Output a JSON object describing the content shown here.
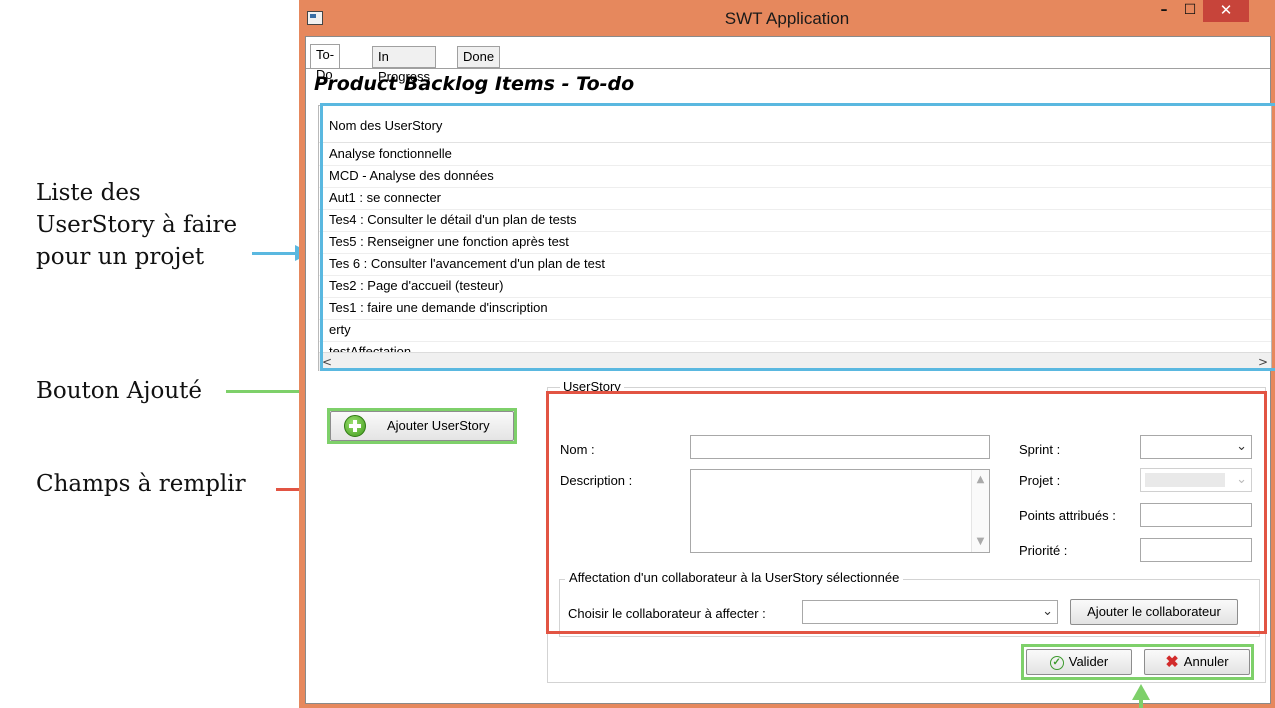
{
  "annotations": {
    "list_label": [
      "Liste des",
      "UserStory à faire",
      "pour un projet"
    ],
    "add_button_label": "Bouton Ajouté",
    "fields_label": "Champs à remplir",
    "colors": {
      "blue": "#5ab8e0",
      "green": "#7ed06a",
      "red": "#e25443"
    }
  },
  "window": {
    "title": "SWT Application",
    "minimize": "–",
    "maximize": "☐",
    "close": "✕",
    "frame_color": "#e6885d"
  },
  "tabs": [
    {
      "label": "To-Do",
      "active": true
    },
    {
      "label": "In Progress",
      "active": false
    },
    {
      "label": "Done",
      "active": false
    }
  ],
  "heading": "Product Backlog Items - To-do",
  "table": {
    "column": "Nom des UserStory",
    "rows": [
      "Analyse fonctionnelle",
      "MCD - Analyse des données",
      "Aut1 : se connecter",
      "Tes4 : Consulter le détail d'un plan de tests",
      "Tes5 : Renseigner une fonction après test",
      "Tes 6 : Consulter l'avancement d'un plan de test",
      "Tes2 : Page d'accueil (testeur)",
      "Tes1 : faire une demande d'inscription",
      "erty",
      "testAffectation"
    ],
    "scroll_left": "<",
    "scroll_right": ">"
  },
  "add_button": {
    "label": "Ajouter UserStory",
    "icon": "plus-circle-icon"
  },
  "form": {
    "legend": "UserStory",
    "nom_label": "Nom :",
    "nom_value": "",
    "description_label": "Description :",
    "description_value": "",
    "sprint_label": "Sprint :",
    "sprint_value": "",
    "projet_label": "Projet :",
    "projet_value": "",
    "points_label": "Points attribués :",
    "points_value": "",
    "priorite_label": "Priorité :",
    "priorite_value": "",
    "affectation": {
      "legend": "Affectation d'un collaborateur à la UserStory sélectionnée",
      "choose_label": "Choisir le collaborateur à affecter :",
      "choose_value": "",
      "add_button": "Ajouter le collaborateur"
    }
  },
  "actions": {
    "valider": "Valider",
    "annuler": "Annuler"
  }
}
